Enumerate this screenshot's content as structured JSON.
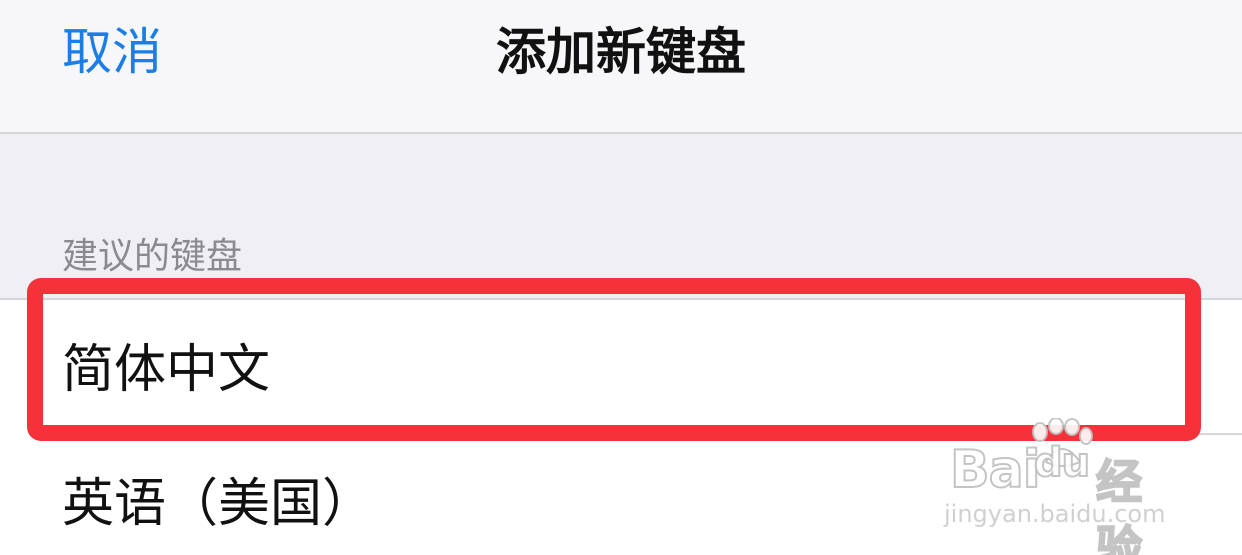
{
  "navbar": {
    "cancel_label": "取消",
    "title": "添加新键盘"
  },
  "section": {
    "header": "建议的键盘"
  },
  "keyboards": [
    {
      "label": "简体中文",
      "highlighted": true
    },
    {
      "label": "英语（美国）",
      "highlighted": false
    }
  ],
  "watermark": {
    "logo_text": "Bai",
    "logo_suffix": "du",
    "cn_text": "经验",
    "url": "jingyan.baidu.com"
  },
  "colors": {
    "accent": "#1a7ee6",
    "highlight_border": "#f5323a",
    "background": "#efeff4"
  }
}
